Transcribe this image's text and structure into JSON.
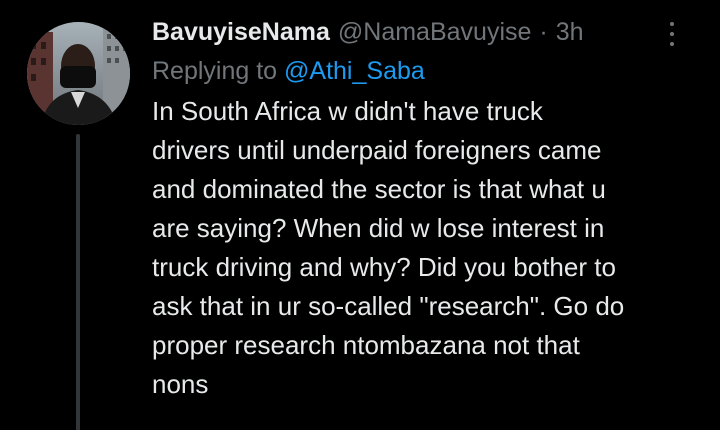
{
  "tweet": {
    "display_name": "BavuyiseNama",
    "handle": "@NamaBavuyise",
    "separator": "·",
    "time": "3h",
    "more_icon": "more-vertical-icon",
    "replying_label": "Replying to",
    "replying_to": "@Athi_Saba",
    "text_lines": [
      "In South Africa w didn't have truck",
      "drivers until underpaid foreigners came",
      "and dominated the sector is that what u",
      "are saying? When did w lose interest in",
      "truck driving and why? Did you bother to",
      "ask that in ur so-called \"research\". Go do",
      "proper research ntombazana not that",
      "nons"
    ]
  },
  "colors": {
    "background": "#000000",
    "primary_text": "#e7e9ea",
    "secondary_text": "#71767b",
    "link": "#1d9bf0",
    "thread_line": "#333639"
  }
}
